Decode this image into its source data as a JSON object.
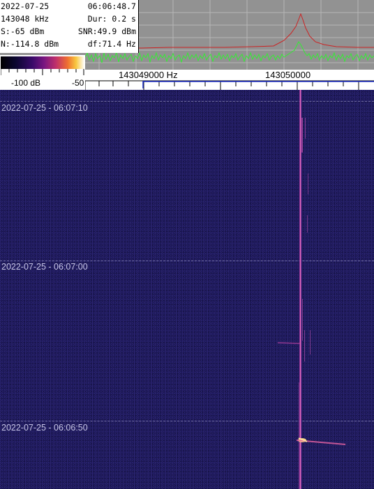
{
  "info": {
    "date": "2022-07-25",
    "time": "06:06:48.7",
    "freq": "143048 kHz",
    "dur": "Dur: 0.2 s",
    "signal": "S:-65 dBm",
    "snr": "SNR:49.9 dBm",
    "noise": "N:-114.8 dBm",
    "df": "df:71.4 Hz"
  },
  "colorbar": {
    "min_label": "-100 dB",
    "max_label": "-50"
  },
  "axis": {
    "label_1": "143049000 Hz",
    "label_2": "143050000"
  },
  "timestamps": [
    "2022-07-25 - 06:07:10",
    "2022-07-25 - 06:07:00",
    "2022-07-25 - 06:06:50"
  ],
  "colors": {
    "spectrum_bg": "#929292",
    "live_trace": "#33ee33",
    "peak_trace": "#cc2222",
    "waterfall_bg": "#1c1858",
    "signal": "#e070c0"
  }
}
